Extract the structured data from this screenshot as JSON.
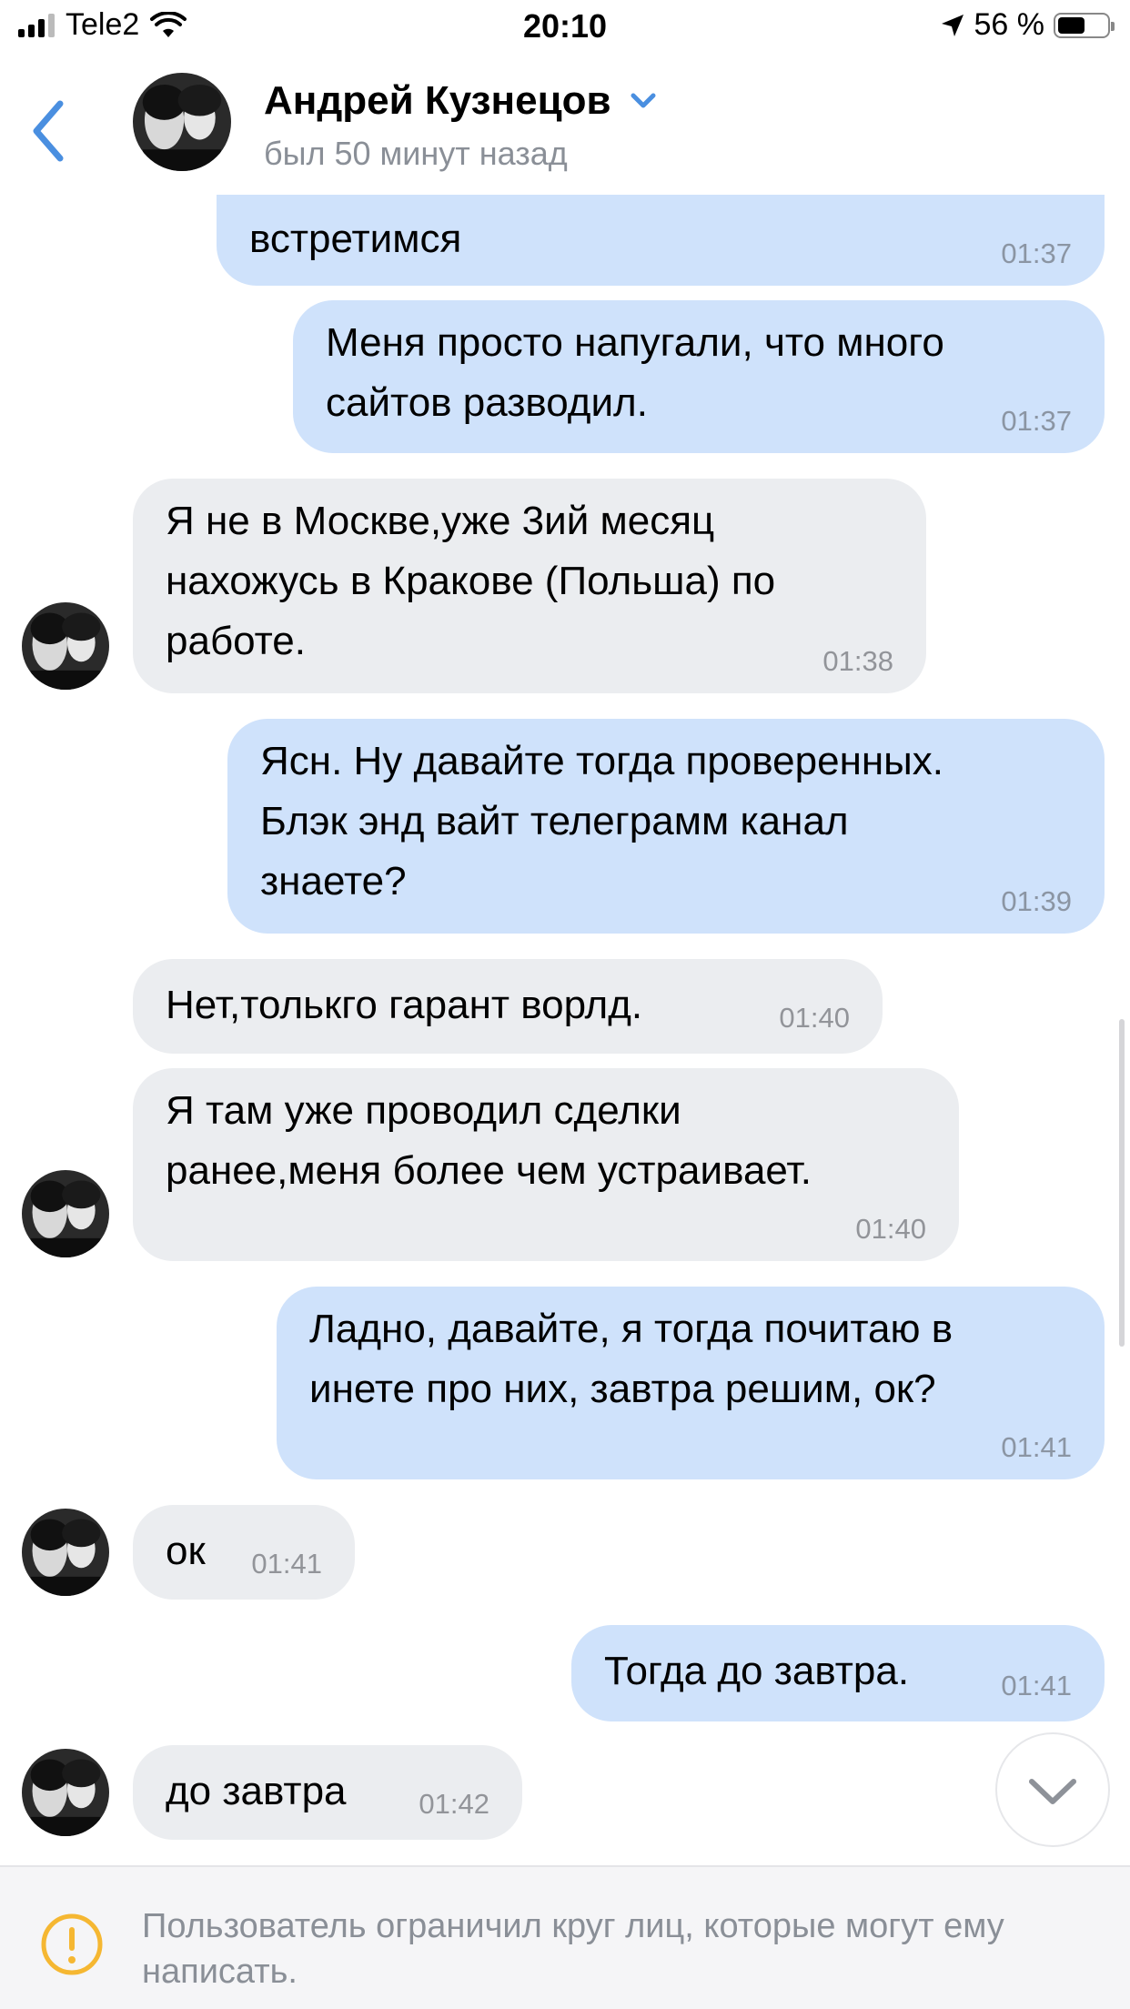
{
  "status_bar": {
    "carrier": "Tele2",
    "time": "20:10",
    "battery_text": "56 %",
    "battery_level": 0.56
  },
  "header": {
    "name": "Андрей Кузнецов",
    "last_seen": "был 50 минут назад"
  },
  "messages": [
    {
      "dir": "out",
      "text": "встретимся",
      "time": "01:37"
    },
    {
      "dir": "out",
      "text": "Меня просто напугали, что много\nсайтов разводил.",
      "time": "01:37"
    },
    {
      "dir": "in",
      "text": "Я не в Москве,уже 3ий месяц\nнахожусь в Кракове (Польша) по\nработе.",
      "time": "01:38"
    },
    {
      "dir": "out",
      "text": "Ясн. Ну давайте тогда проверенных.\nБлэк энд вайт телеграмм канал\nзнаете?",
      "time": "01:39"
    },
    {
      "dir": "in",
      "text": "Нет,толькго гарант ворлд.",
      "time": "01:40"
    },
    {
      "dir": "in",
      "text": "Я там уже проводил сделки\nранее,меня более чем устраивает.",
      "time": "01:40"
    },
    {
      "dir": "out",
      "text": "Ладно, давайте, я тогда почитаю в\nинете про них, завтра решим, ок?",
      "time": "01:41"
    },
    {
      "dir": "in",
      "text": "ок",
      "time": "01:41"
    },
    {
      "dir": "out",
      "text": "Тогда до завтра.",
      "time": "01:41"
    },
    {
      "dir": "in",
      "text": "до завтра",
      "time": "01:42"
    }
  ],
  "footer": {
    "notice": "Пользователь ограничил круг лиц, которые могут ему написать."
  },
  "colors": {
    "accent": "#4a8fe0",
    "outgoing_bubble": "#cfe2fb",
    "incoming_bubble": "#ebedf0",
    "warning": "#f5b732"
  },
  "icons": [
    "back-chevron-icon",
    "dropdown-chevron-icon",
    "scroll-down-chevron-icon",
    "warning-icon",
    "location-arrow-icon",
    "wifi-icon",
    "signal-icon",
    "battery-icon"
  ]
}
